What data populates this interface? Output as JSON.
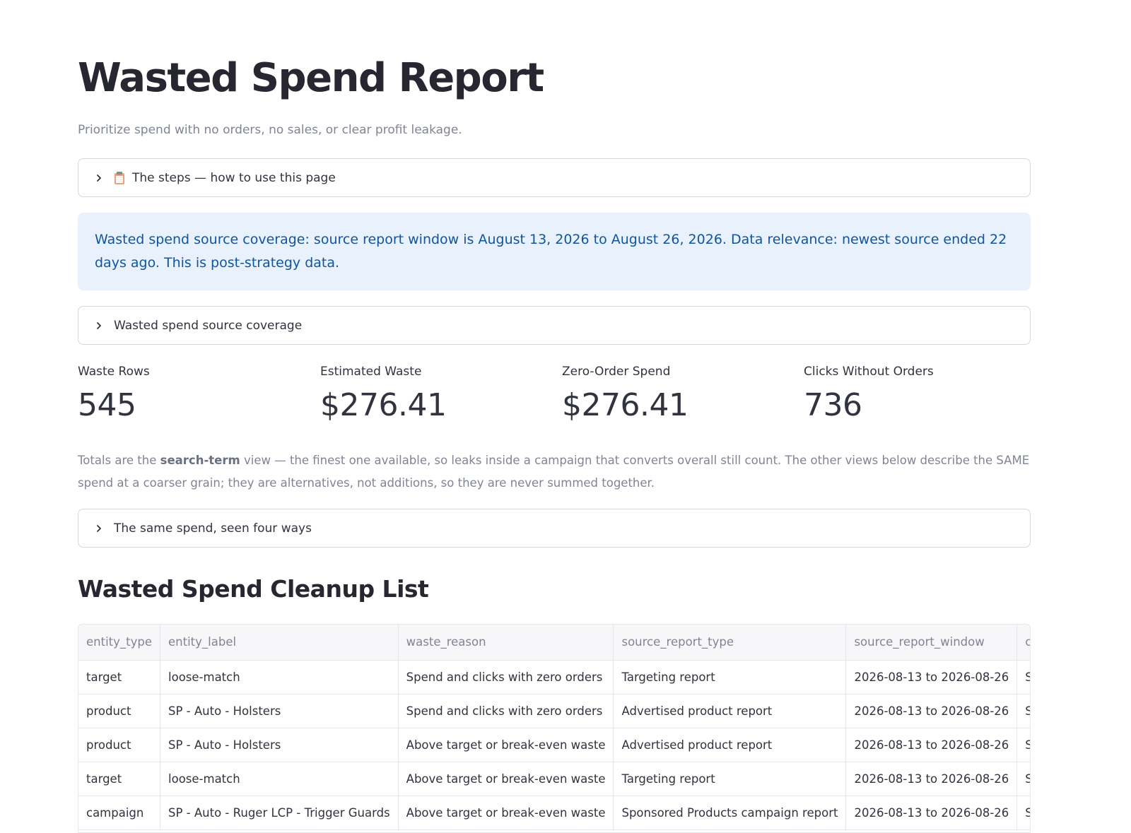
{
  "page": {
    "title": "Wasted Spend Report",
    "subtitle": "Prioritize spend with no orders, no sales, or clear profit leakage."
  },
  "expanders": {
    "steps": {
      "label": "The steps — how to use this page",
      "icon": "clipboard-icon"
    },
    "coverage": {
      "label": "Wasted spend source coverage"
    },
    "four_ways": {
      "label": "The same spend, seen four ways"
    }
  },
  "info": {
    "text": "Wasted spend source coverage: source report window is August 13, 2026 to August 26, 2026. Data relevance: newest source ended 22 days ago. This is post-strategy data."
  },
  "metrics": [
    {
      "label": "Waste Rows",
      "value": "545"
    },
    {
      "label": "Estimated Waste",
      "value": "$276.41"
    },
    {
      "label": "Zero-Order Spend",
      "value": "$276.41"
    },
    {
      "label": "Clicks Without Orders",
      "value": "736"
    }
  ],
  "note": {
    "prefix": "Totals are the ",
    "bold": "search-term",
    "suffix": " view — the finest one available, so leaks inside a campaign that converts overall still count. The other views below describe the SAME spend at a coarser grain; they are alternatives, not additions, so they are never summed together."
  },
  "cleanup": {
    "heading": "Wasted Spend Cleanup List",
    "columns": [
      "entity_type",
      "entity_label",
      "waste_reason",
      "source_report_type",
      "source_report_window",
      "campa"
    ],
    "rows": [
      [
        "target",
        "loose-match",
        "Spend and clicks with zero orders",
        "Targeting report",
        "2026-08-13 to 2026-08-26",
        "SP - Au"
      ],
      [
        "product",
        "SP - Auto - Holsters",
        "Spend and clicks with zero orders",
        "Advertised product report",
        "2026-08-13 to 2026-08-26",
        "SP - Au"
      ],
      [
        "product",
        "SP - Auto - Holsters",
        "Above target or break-even waste",
        "Advertised product report",
        "2026-08-13 to 2026-08-26",
        "SP - Au"
      ],
      [
        "target",
        "loose-match",
        "Above target or break-even waste",
        "Targeting report",
        "2026-08-13 to 2026-08-26",
        "SP - Au"
      ],
      [
        "campaign",
        "SP - Auto - Ruger LCP - Trigger Guards",
        "Above target or break-even waste",
        "Sponsored Products campaign report",
        "2026-08-13 to 2026-08-26",
        "SP - Au"
      ]
    ]
  }
}
